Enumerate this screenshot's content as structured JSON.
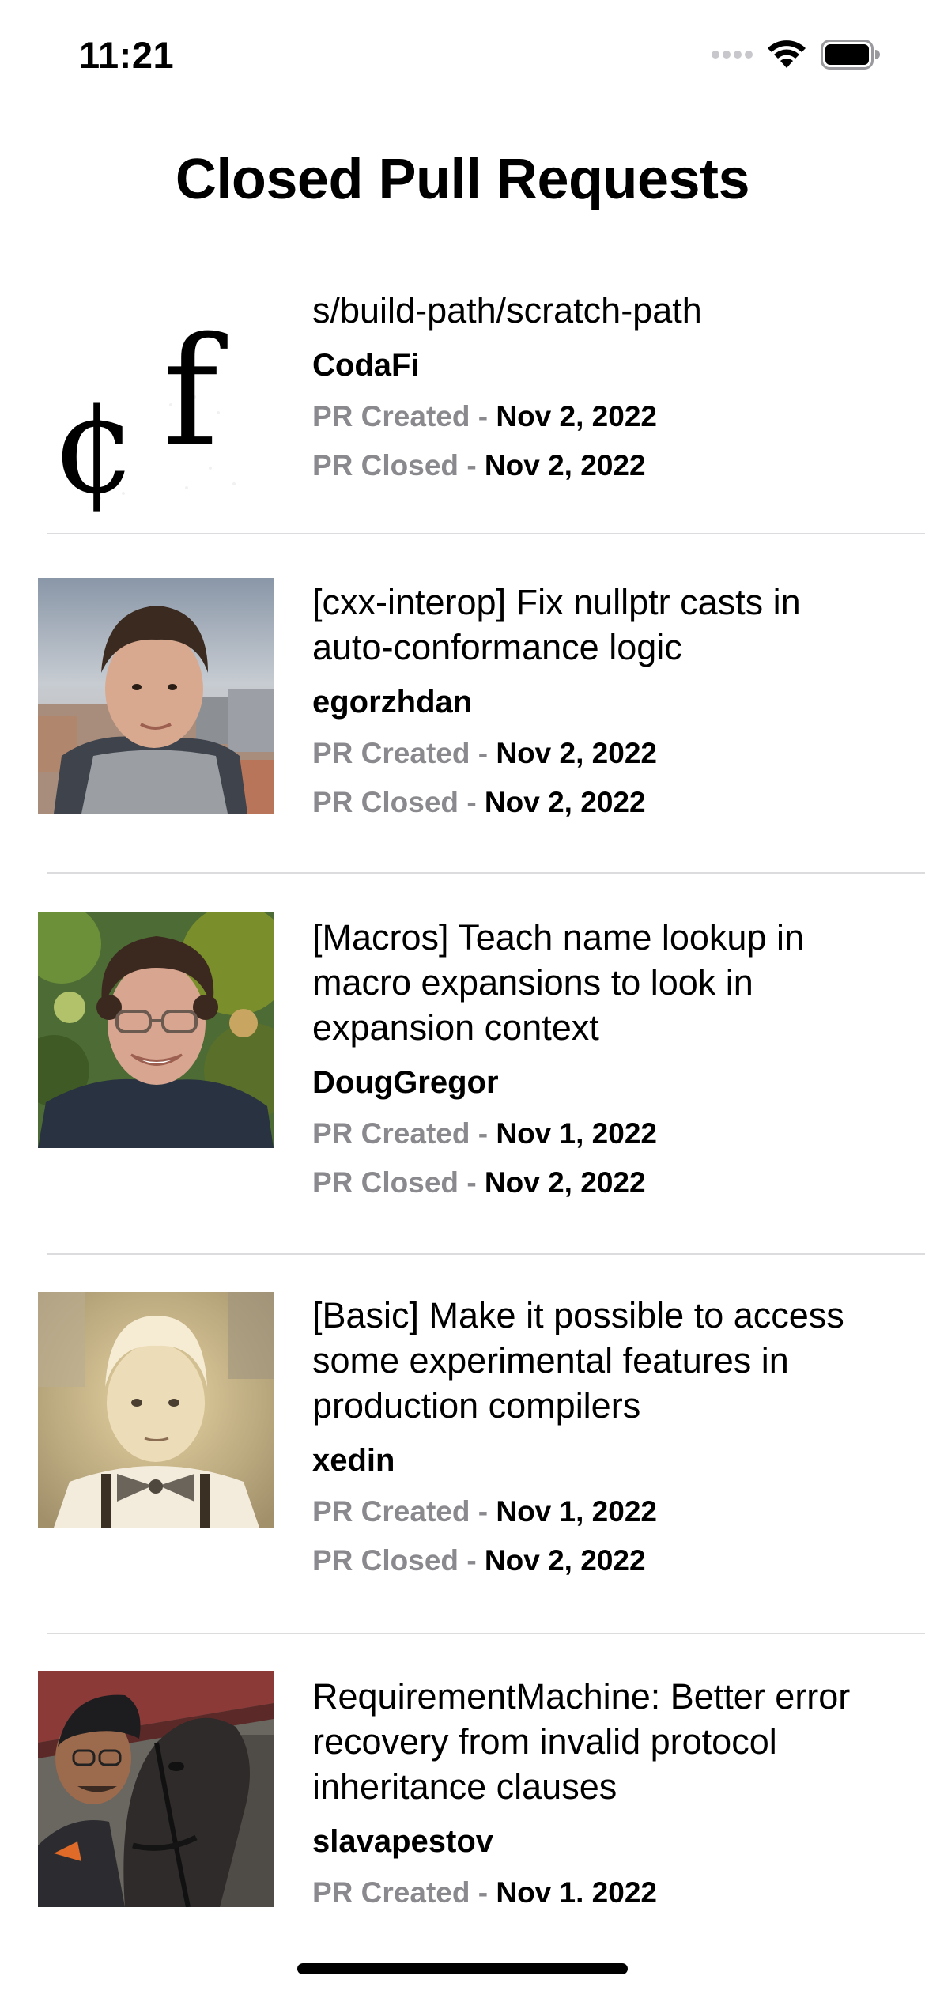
{
  "status_bar": {
    "time": "11:21"
  },
  "page": {
    "title": "Closed Pull Requests"
  },
  "labels": {
    "created": "PR Created - ",
    "closed": "PR Closed - "
  },
  "pull_requests": [
    {
      "title": "s/build-path/scratch-path",
      "author": "CodaFi",
      "created": "Nov 2, 2022",
      "closed": "Nov 2, 2022",
      "avatar": "codafi-logo"
    },
    {
      "title": "[cxx-interop] Fix nullptr casts in auto-conformance logic",
      "author": "egorzhdan",
      "created": "Nov 2, 2022",
      "closed": "Nov 2, 2022",
      "avatar": "photo-young-man-city"
    },
    {
      "title": "[Macros] Teach name lookup in macro expansions to look in expansion context",
      "author": "DougGregor",
      "created": "Nov 1, 2022",
      "closed": "Nov 2, 2022",
      "avatar": "photo-man-glasses-trees"
    },
    {
      "title": "[Basic] Make it possible to access some experimental features in production compilers",
      "author": "xedin",
      "created": "Nov 1, 2022",
      "closed": "Nov 2, 2022",
      "avatar": "photo-vintage-child-bowtie"
    },
    {
      "title": "RequirementMachine: Better error recovery from invalid protocol inheritance clauses",
      "author": "slavapestov",
      "created": "Nov 1. 2022",
      "closed": "",
      "avatar": "photo-man-with-horse"
    }
  ],
  "colors": {
    "secondary_label": "#8a8a8e",
    "separator": "#dcdcdf"
  }
}
